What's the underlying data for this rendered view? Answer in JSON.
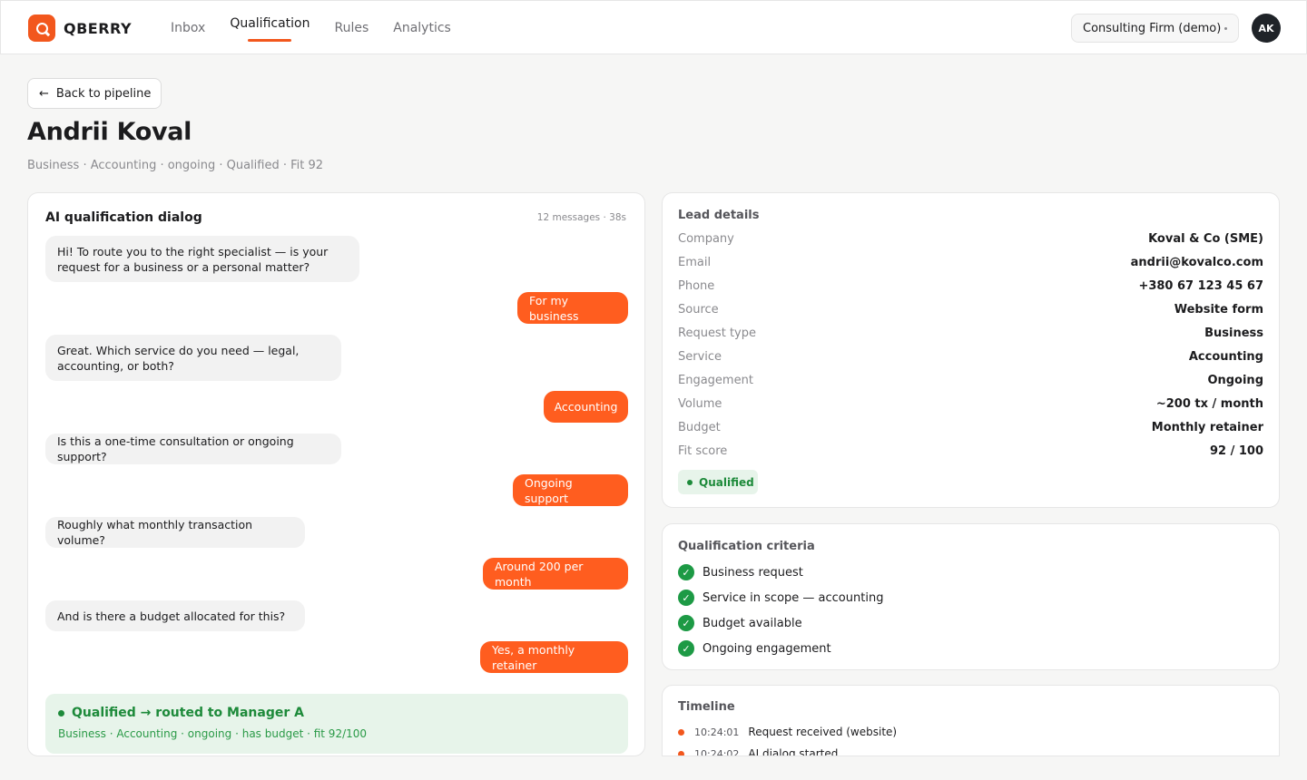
{
  "app": {
    "name": "QBERRY",
    "logo_letter": "Q",
    "accent": "#f2571d"
  },
  "nav": {
    "items": [
      {
        "label": "Inbox",
        "active": false
      },
      {
        "label": "Qualification",
        "active": true
      },
      {
        "label": "Rules",
        "active": false
      },
      {
        "label": "Analytics",
        "active": false
      }
    ]
  },
  "org": {
    "selected": "Consulting Firm (demo)"
  },
  "user": {
    "initials": "AK"
  },
  "header": {
    "back_label": "Back to pipeline",
    "lead_name": "Andrii Koval",
    "meta": "Business · Accounting · ongoing · Qualified · Fit 92"
  },
  "dialog": {
    "title": "AI qualification dialog",
    "stats": "12 messages · 38s",
    "messages": [
      {
        "role": "bot",
        "text": "Hi! To route you to the right specialist — is your request for a business or a personal matter?"
      },
      {
        "role": "user",
        "text": "For my business"
      },
      {
        "role": "bot",
        "text": "Great. Which service do you need — legal, accounting, or both?"
      },
      {
        "role": "user",
        "text": "Accounting"
      },
      {
        "role": "bot",
        "text": "Is this a one-time consultation or ongoing support?"
      },
      {
        "role": "user",
        "text": "Ongoing support"
      },
      {
        "role": "bot",
        "text": "Roughly what monthly transaction volume?"
      },
      {
        "role": "user",
        "text": "Around 200 per month"
      },
      {
        "role": "bot",
        "text": "And is there a budget allocated for this?"
      },
      {
        "role": "user",
        "text": "Yes, a monthly retainer"
      }
    ],
    "result": {
      "title": "Qualified → routed to Manager A",
      "summary": "Business · Accounting · ongoing · has budget · fit 92/100"
    }
  },
  "details": {
    "title": "Lead details",
    "rows": [
      {
        "label": "Company",
        "value": "Koval & Co (SME)"
      },
      {
        "label": "Email",
        "value": "andrii@kovalco.com"
      },
      {
        "label": "Phone",
        "value": "+380 67 123 45 67"
      },
      {
        "label": "Source",
        "value": "Website form"
      },
      {
        "label": "Request type",
        "value": "Business"
      },
      {
        "label": "Service",
        "value": "Accounting"
      },
      {
        "label": "Engagement",
        "value": "Ongoing"
      },
      {
        "label": "Volume",
        "value": "~200 tx / month"
      },
      {
        "label": "Budget",
        "value": "Monthly retainer"
      },
      {
        "label": "Fit score",
        "value": "92 / 100"
      }
    ],
    "status": "Qualified"
  },
  "criteria": {
    "title": "Qualification criteria",
    "items": [
      "Business request",
      "Service in scope — accounting",
      "Budget available",
      "Ongoing engagement"
    ]
  },
  "timeline": {
    "title": "Timeline",
    "events": [
      {
        "time": "10:24:01",
        "text": "Request received (website)"
      },
      {
        "time": "10:24:02",
        "text": "AI dialog started"
      }
    ]
  },
  "colors": {
    "accent": "#f2571d",
    "user_bubble": "#ff5d1f",
    "success": "#1d8a3a",
    "success_bg": "#e7f4ea"
  }
}
